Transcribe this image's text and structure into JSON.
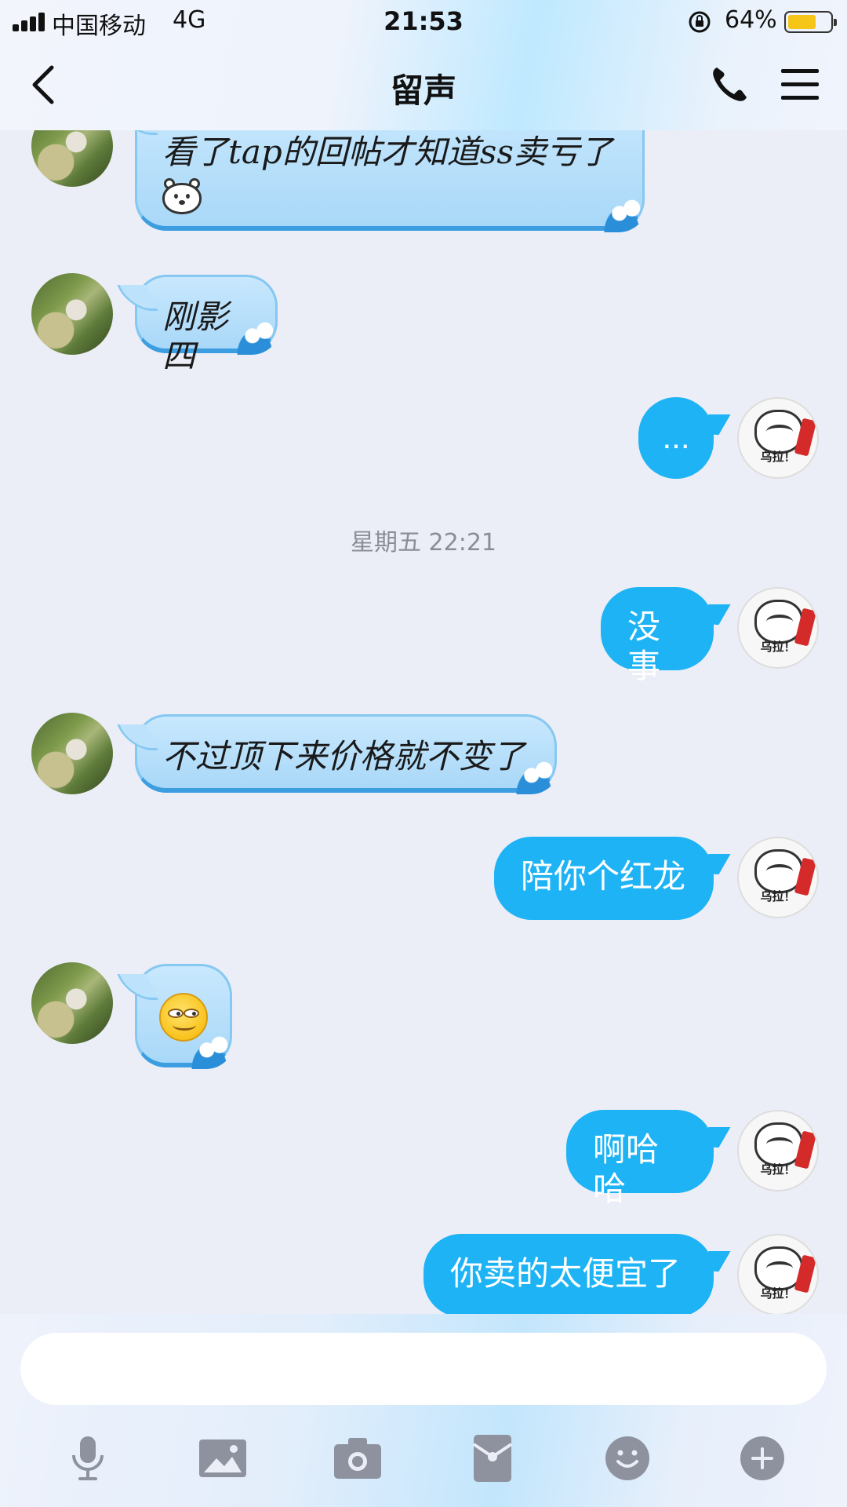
{
  "status_bar": {
    "carrier": "中国移动",
    "network": "4G",
    "time": "21:53",
    "battery_percent": "64%",
    "battery_level": 0.64
  },
  "header": {
    "title": "留声"
  },
  "messages": [
    {
      "side": "other",
      "text": "看了tap的回帖才知道ss卖亏了",
      "has_sticker": "polar-bear-icon"
    },
    {
      "side": "other",
      "text": "刚影四"
    },
    {
      "side": "me",
      "text": "..."
    },
    {
      "side": "timestamp",
      "text": "星期五 22:21"
    },
    {
      "side": "me",
      "text": "没事"
    },
    {
      "side": "other",
      "text": "不过顶下来价格就不变了"
    },
    {
      "side": "me",
      "text": "陪你个红龙"
    },
    {
      "side": "other",
      "text": "",
      "emoji": "smirk-emoji"
    },
    {
      "side": "me",
      "text": "啊哈哈"
    },
    {
      "side": "me",
      "text": "你卖的太便宜了"
    }
  ],
  "my_avatar_caption": "乌拉！",
  "input": {
    "value": ""
  },
  "toolbar": [
    "microphone-icon",
    "image-icon",
    "camera-icon",
    "red-packet-icon",
    "emoji-icon",
    "plus-icon"
  ],
  "colors": {
    "my_bubble": "#1EB3F5",
    "other_bubble": "#B8E0FB",
    "background": "#ECEEF7"
  }
}
